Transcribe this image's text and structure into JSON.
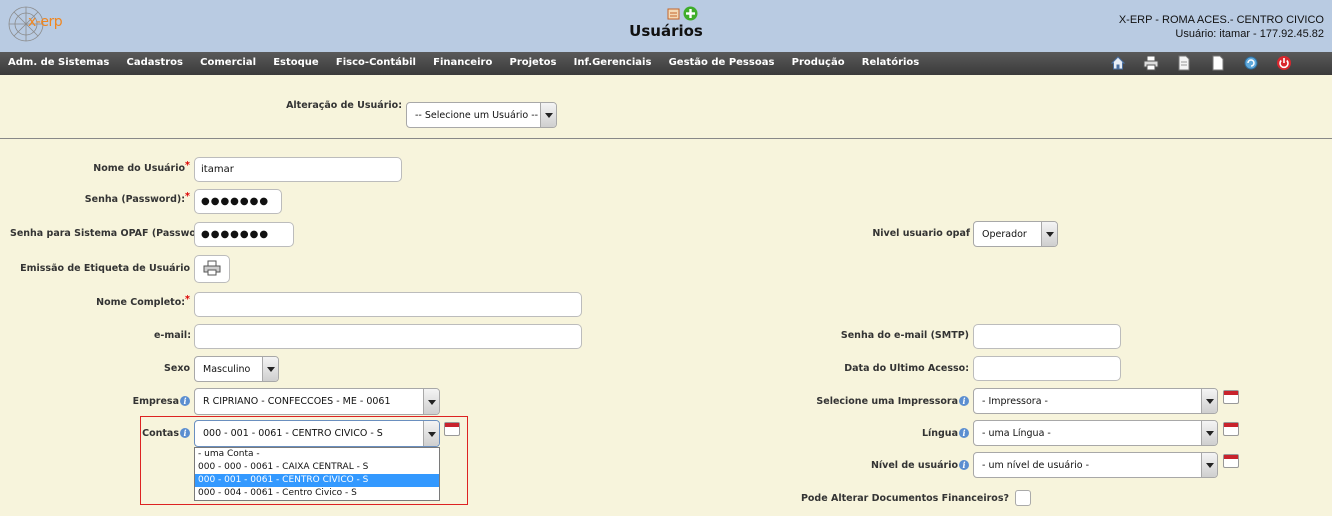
{
  "header": {
    "logo_text": "x-erp",
    "page_title": "Usuários",
    "company": "X-ERP - ROMA ACES.- CENTRO CIVICO",
    "user_line": "Usuário: itamar - 177.92.45.82"
  },
  "nav": {
    "items": [
      "Adm. de Sistemas",
      "Cadastros",
      "Comercial",
      "Estoque",
      "Fisco-Contábil",
      "Financeiro",
      "Projetos",
      "Inf.Gerenciais",
      "Gestão de Pessoas",
      "Produção",
      "Relatórios"
    ],
    "tools": [
      "home-icon",
      "print-icon",
      "document-icon",
      "page-icon",
      "refresh-icon",
      "power-icon"
    ]
  },
  "form": {
    "alteracao_label": "Alteração de Usuário:",
    "alteracao_value": "-- Selecione um Usuário --",
    "nome_usuario_label": "Nome do Usuário",
    "nome_usuario_value": "itamar",
    "senha_label": "Senha (Password):",
    "senha_value": "●●●●●●●",
    "senha_opaf_label": "Senha para Sistema OPAF (Password):",
    "senha_opaf_value": "●●●●●●●",
    "nivel_opaf_label": "Nivel usuario opaf",
    "nivel_opaf_value": "Operador",
    "etiqueta_label": "Emissão de Etiqueta de Usuário",
    "nome_completo_label": "Nome Completo:",
    "nome_completo_value": "",
    "email_label": "e-mail:",
    "email_value": "",
    "senha_smtp_label": "Senha do e-mail (SMTP)",
    "sexo_label": "Sexo",
    "sexo_value": "Masculino",
    "ultimo_acesso_label": "Data do Ultimo Acesso:",
    "empresa_label": "Empresa",
    "empresa_value": "R CIPRIANO - CONFECCOES - ME - 0061",
    "impressora_label": "Selecione uma Impressora",
    "impressora_value": "- Impressora -",
    "contas_label": "Contas",
    "contas_value": "000 - 001 - 0061 - CENTRO CIVICO - S",
    "contas_options": [
      "- uma Conta -",
      "000 - 000 - 0061 - CAIXA CENTRAL - S",
      "000 - 001 - 0061 - CENTRO CIVICO - S",
      "000 - 004 - 0061 - Centro Civico - S"
    ],
    "contas_selected_index": 2,
    "lingua_label": "Língua",
    "lingua_value": "- uma Língua -",
    "nivel_usuario_label": "Nível de usuário",
    "nivel_usuario_value": "- um nível de usuário -",
    "pode_alterar_label": "Pode Alterar Documentos Financeiros?"
  },
  "colors": {
    "header_bg": "#b9cbe2",
    "nav_bg": "#3a3a3a",
    "page_bg": "#f7f4dc",
    "accent_orange": "#f0861f",
    "required": "#dd0000"
  }
}
